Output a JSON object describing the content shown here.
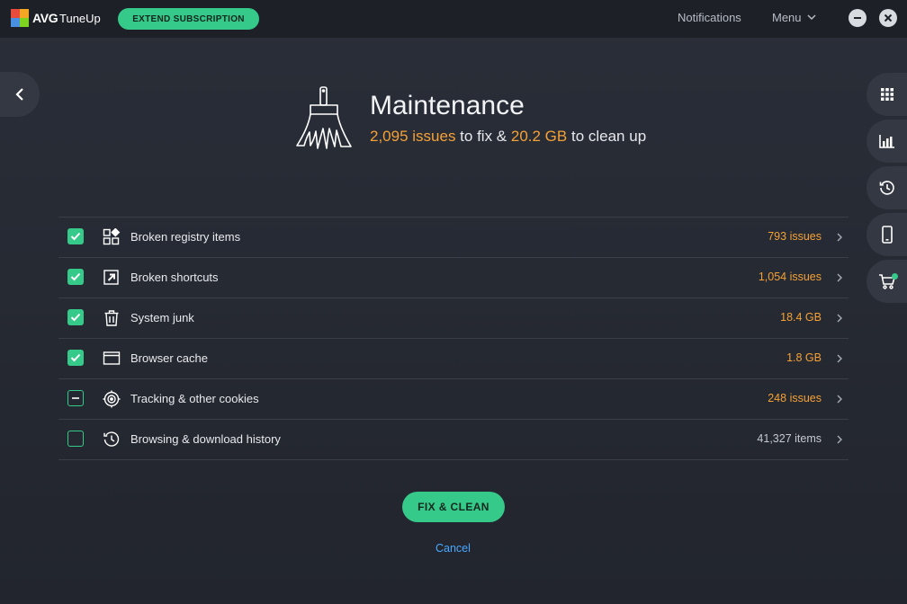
{
  "titlebar": {
    "brand": "AVG",
    "product": "TuneUp",
    "extend_label": "EXTEND SUBSCRIPTION",
    "notifications_label": "Notifications",
    "menu_label": "Menu",
    "logo_colors": [
      "#e84c3d",
      "#f5a623",
      "#4a90e2",
      "#7ed321"
    ]
  },
  "header": {
    "title": "Maintenance",
    "issues_count": "2,095 issues",
    "middle_text": " to fix & ",
    "size": "20.2 GB",
    "end_text": " to clean up"
  },
  "items": [
    {
      "label": "Broken registry items",
      "value": "793 issues",
      "state": "checked",
      "icon": "registry-icon",
      "highlight": true
    },
    {
      "label": "Broken shortcuts",
      "value": "1,054 issues",
      "state": "checked",
      "icon": "shortcut-icon",
      "highlight": true
    },
    {
      "label": "System junk",
      "value": "18.4 GB",
      "state": "checked",
      "icon": "trash-icon",
      "highlight": true
    },
    {
      "label": "Browser cache",
      "value": "1.8 GB",
      "state": "checked",
      "icon": "browser-window-icon",
      "highlight": true
    },
    {
      "label": "Tracking & other cookies",
      "value": "248 issues",
      "state": "partial",
      "icon": "target-icon",
      "highlight": true
    },
    {
      "label": "Browsing & download history",
      "value": "41,327 items",
      "state": "unchecked",
      "icon": "history-icon",
      "highlight": false
    }
  ],
  "actions": {
    "fix_label": "FIX & CLEAN",
    "cancel_label": "Cancel"
  },
  "colors": {
    "accent_green": "#35c98a",
    "accent_orange": "#f5a136",
    "link_blue": "#4aa8ff",
    "background": "#262a33"
  }
}
